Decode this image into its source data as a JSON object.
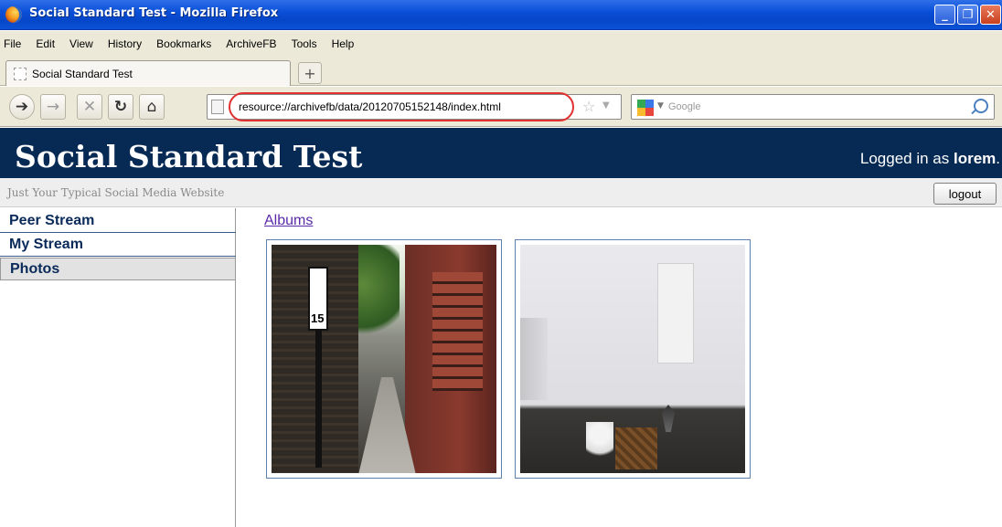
{
  "window": {
    "title": "Social Standard Test - Mozilla Firefox",
    "min_icon": "_",
    "max_icon": "❐",
    "close_icon": "✕"
  },
  "menu": {
    "items": [
      "File",
      "Edit",
      "View",
      "History",
      "Bookmarks",
      "ArchiveFB",
      "Tools",
      "Help"
    ]
  },
  "tabs": {
    "active_label": "Social Standard Test",
    "new_tab_label": "+"
  },
  "toolbar": {
    "url": "resource://archivefb/data/20120705152148/index.html",
    "search_placeholder": "Google",
    "highlight_color": "#e03030"
  },
  "page": {
    "site_title": "Social Standard Test",
    "login_prefix": "Logged in as ",
    "login_user": "lorem",
    "login_suffix": ".",
    "tagline": "Just Your Typical Social Media Website",
    "logout_label": "logout",
    "header_color": "#072a55"
  },
  "sidebar": {
    "items": [
      {
        "label": "Peer Stream",
        "active": false
      },
      {
        "label": "My Stream",
        "active": false
      },
      {
        "label": "Photos",
        "active": true
      }
    ]
  },
  "main": {
    "albums_link": "Albums",
    "photos": [
      {
        "subject": "alley-with-speed-limit-sign",
        "sign_text": "15"
      },
      {
        "subject": "white-room-with-basket"
      }
    ]
  }
}
